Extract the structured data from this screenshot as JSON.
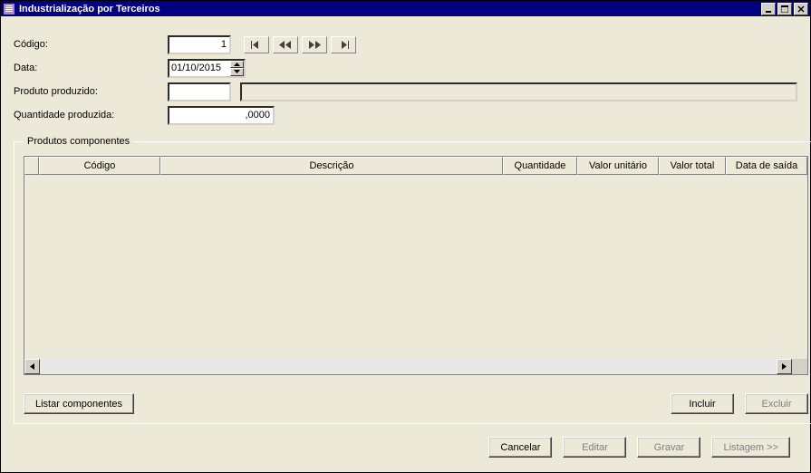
{
  "window": {
    "title": "Industrialização por Terceiros"
  },
  "form": {
    "codigo_label": "Código:",
    "codigo_value": "1",
    "data_label": "Data:",
    "data_value": "01/10/2015",
    "produto_label": "Produto produzido:",
    "produto_value": "",
    "produto_desc": "",
    "qty_label": "Quantidade produzida:",
    "qty_value": ",0000"
  },
  "group": {
    "legend": "Produtos componentes",
    "columns": {
      "codigo": "Código",
      "descricao": "Descrição",
      "quantidade": "Quantidade",
      "valor_unitario": "Valor unitário",
      "valor_total": "Valor total",
      "data_saida": "Data de saída"
    },
    "listar_btn": "Listar componentes",
    "incluir_btn": "Incluir",
    "excluir_btn": "Excluir"
  },
  "footer": {
    "cancelar": "Cancelar",
    "editar": "Editar",
    "gravar": "Gravar",
    "listagem": "Listagem >>"
  }
}
